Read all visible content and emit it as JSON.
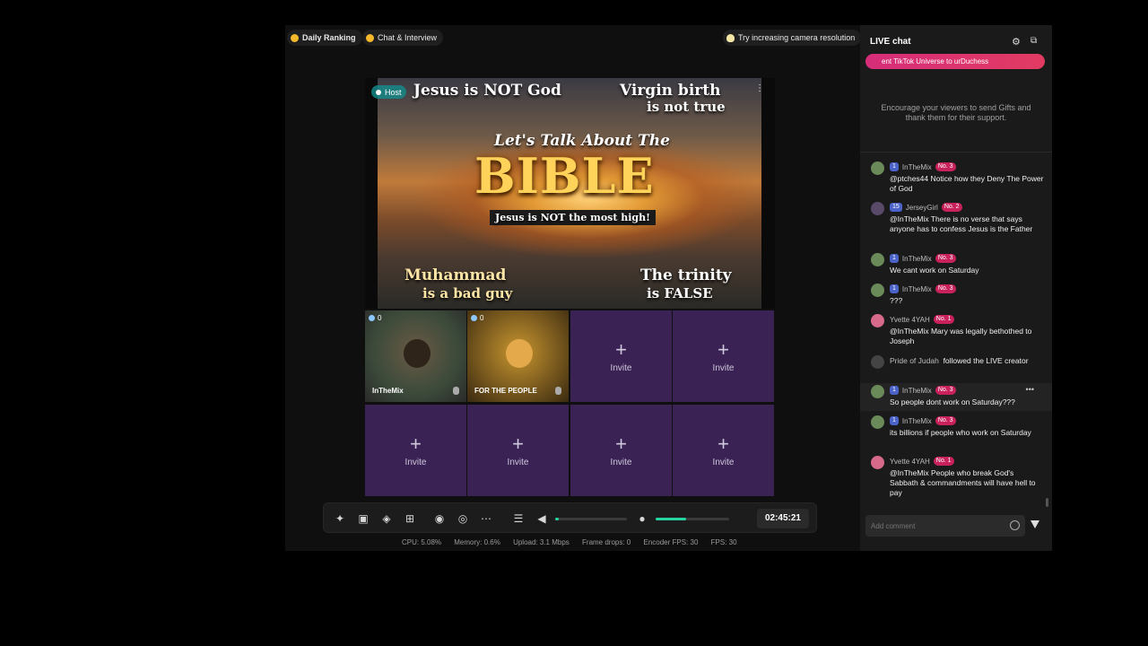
{
  "top_pills": {
    "daily_ranking": "Daily Ranking",
    "chat_interview": "Chat & Interview",
    "tip": "Try increasing camera resolution"
  },
  "host": {
    "tag": "Host",
    "headline_top_left": "Jesus is NOT God",
    "headline_top_right_1": "Virgin birth",
    "headline_top_right_2": "is not true",
    "headline_center": "Let's Talk About The",
    "headline_bible": "BIBLE",
    "headline_sub": "Jesus is NOT the most high!",
    "headline_bottom_left_1": "Muhammad",
    "headline_bottom_left_2": "is a bad guy",
    "headline_bottom_right_1": "The trinity",
    "headline_bottom_right_2": "is FALSE"
  },
  "guests": [
    {
      "name": "InTheMix",
      "viewers": "0"
    },
    {
      "name": "FOR THE PEOPLE",
      "viewers": "0"
    }
  ],
  "invite": {
    "label": "Invite",
    "plus": "+"
  },
  "toolbar": {
    "icons": [
      "magic-wand-icon",
      "layout-icon",
      "effects-icon",
      "add-source-icon",
      "record-icon",
      "camera-switch-icon",
      "more-icon",
      "adjust-icon",
      "speaker-icon",
      "mic-icon"
    ],
    "timer": "02:45:21",
    "volume_level": 0.05,
    "mic_level": 0.42
  },
  "stats": {
    "cpu": "CPU:  5.08%",
    "memory": "Memory:  0.6%",
    "upload": "Upload:  3.1 Mbps",
    "frame_drops": "Frame drops:  0",
    "encoder_fps": "Encoder FPS:  30",
    "fps": "FPS:  30"
  },
  "chat": {
    "title": "LIVE chat",
    "gift_banner": "ent TikTok Universe to  urDuchess",
    "gift_note": "Encourage your viewers to send Gifts and thank them for their support.",
    "comment_placeholder": "Add comment",
    "messages": [
      {
        "level": "1",
        "user": "InTheMix",
        "rank": "No. 3",
        "text": "@ptches44 Notice how they Deny The Power of God"
      },
      {
        "level": "15",
        "user": "JerseyGirl",
        "rank": "No. 2",
        "text": "@InTheMix There is no verse that says anyone has to confess Jesus is the Father"
      },
      {
        "level": "1",
        "user": "InTheMix",
        "rank": "No. 3",
        "text": "We cant work on Saturday"
      },
      {
        "level": "1",
        "user": "InTheMix",
        "rank": "No. 3",
        "text": "???"
      },
      {
        "level": "",
        "user": "Yvette 4YAH",
        "rank": "No. 1",
        "text": "@InTheMix Mary was legally bethothed to Joseph"
      },
      {
        "level": "",
        "user": "Pride of Judah",
        "rank": "",
        "text": "followed the LIVE creator"
      },
      {
        "level": "1",
        "user": "InTheMix",
        "rank": "No. 3",
        "text": "So people dont work on Saturday???"
      },
      {
        "level": "1",
        "user": "InTheMix",
        "rank": "No. 3",
        "text": "its billions if people who work on Saturday"
      },
      {
        "level": "",
        "user": "Yvette 4YAH",
        "rank": "No. 1",
        "text": "@InTheMix People who break God's Sabbath & commandments will have hell to pay"
      }
    ]
  }
}
